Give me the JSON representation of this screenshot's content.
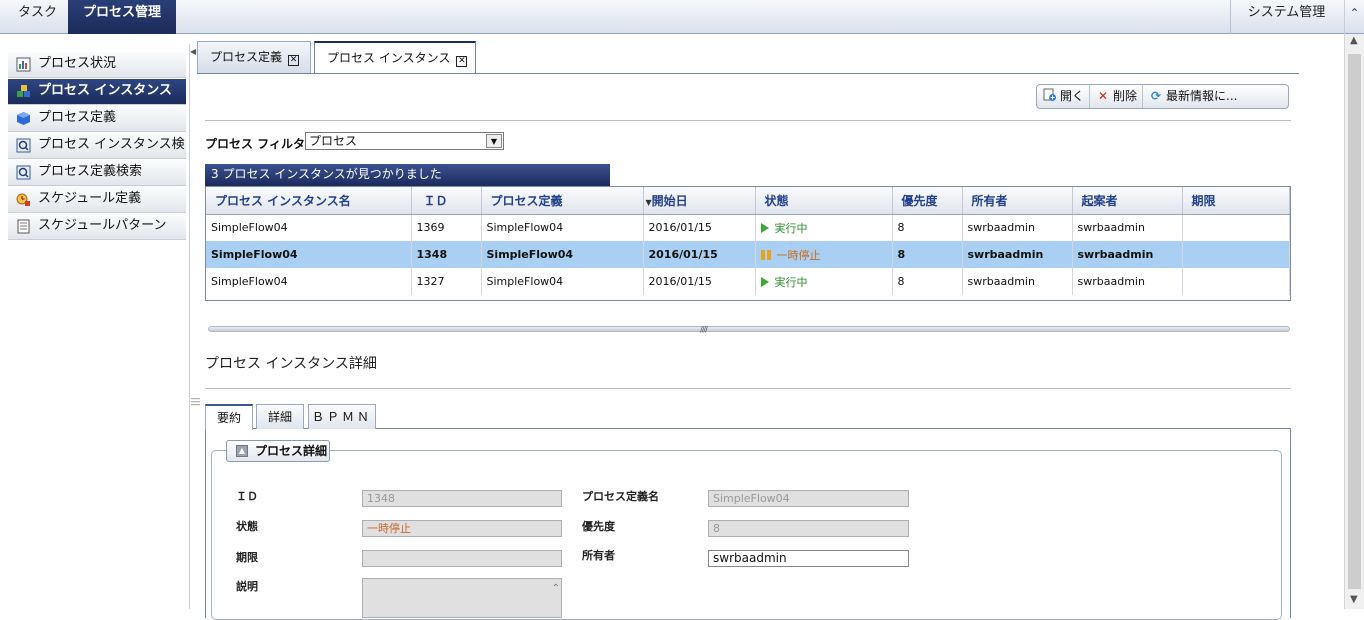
{
  "topnav": {
    "task": "タスク",
    "process_mgmt": "プロセス管理",
    "system_mgmt": "システム管理"
  },
  "sidebar": {
    "items": [
      {
        "label": "プロセス状況",
        "icon": "process-status-icon"
      },
      {
        "label": "プロセス インスタンス",
        "icon": "process-instance-icon",
        "active": true
      },
      {
        "label": "プロセス定義",
        "icon": "process-definition-icon"
      },
      {
        "label": "プロセス インスタンス検...",
        "icon": "instance-search-icon"
      },
      {
        "label": "プロセス定義検索",
        "icon": "definition-search-icon"
      },
      {
        "label": "スケジュール定義",
        "icon": "schedule-definition-icon"
      },
      {
        "label": "スケジュールパターン",
        "icon": "schedule-pattern-icon"
      }
    ]
  },
  "tabs": {
    "definition": "プロセス定義",
    "instance": "プロセス インスタンス"
  },
  "toolbar": {
    "open": "開く",
    "delete": "削除",
    "refresh": "最新情報に..."
  },
  "filter": {
    "label": "プロセス フィルタ:",
    "value": "プロセス"
  },
  "grid": {
    "banner": "3 プロセス インスタンスが見つかりました",
    "columns": [
      "プロセス インスタンス名",
      "ＩＤ",
      "プロセス定義",
      "開始日",
      "状態",
      "優先度",
      "所有者",
      "起案者",
      "期限"
    ],
    "sorted_column_index": 3,
    "rows": [
      {
        "name": "SimpleFlow04",
        "id": "1369",
        "definition": "SimpleFlow04",
        "start": "2016/01/15",
        "status": "実行中",
        "status_kind": "running",
        "priority": "8",
        "owner": "swrbaadmin",
        "initiator": "swrbaadmin",
        "due": ""
      },
      {
        "name": "SimpleFlow04",
        "id": "1348",
        "definition": "SimpleFlow04",
        "start": "2016/01/15",
        "status": "一時停止",
        "status_kind": "paused",
        "priority": "8",
        "owner": "swrbaadmin",
        "initiator": "swrbaadmin",
        "due": "",
        "selected": true
      },
      {
        "name": "SimpleFlow04",
        "id": "1327",
        "definition": "SimpleFlow04",
        "start": "2016/01/15",
        "status": "実行中",
        "status_kind": "running",
        "priority": "8",
        "owner": "swrbaadmin",
        "initiator": "swrbaadmin",
        "due": ""
      }
    ]
  },
  "detail": {
    "title": "プロセス インスタンス詳細",
    "tabs": [
      "要約",
      "詳細",
      "ＢＰＭＮ"
    ],
    "section": "プロセス詳細",
    "labels": {
      "id": "ＩＤ",
      "status": "状態",
      "due": "期限",
      "description": "説明",
      "def_name": "プロセス定義名",
      "priority": "優先度",
      "owner": "所有者"
    },
    "values": {
      "id": "1348",
      "status": "一時停止",
      "due": "",
      "description": "",
      "def_name": "SimpleFlow04",
      "priority": "8",
      "owner": "swrbaadmin"
    }
  },
  "colors": {
    "nav_dark": "#1c2b5c",
    "header_text": "#23408a",
    "selected_row": "#a9d0f2",
    "running": "#2f8a2f",
    "paused": "#cc6a1c"
  }
}
